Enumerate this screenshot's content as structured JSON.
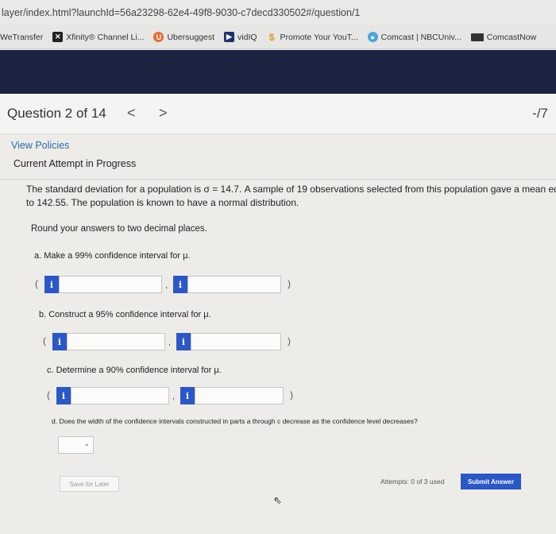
{
  "browser": {
    "url": "layer/index.html?launchId=56a23298-62e4-49f8-9030-c7decd330502#/question/1",
    "bookmarks": [
      {
        "label": "WeTransfer",
        "icon": "none"
      },
      {
        "label": "Xfinity® Channel Li...",
        "icon": "x-icon"
      },
      {
        "label": "Ubersuggest",
        "icon": "ubersuggest-icon"
      },
      {
        "label": "vidIQ",
        "icon": "vidiq-icon"
      },
      {
        "label": "Promote Your YouT...",
        "icon": "dollar-icon"
      },
      {
        "label": "Comcast | NBCUniv...",
        "icon": "comcast-icon"
      },
      {
        "label": "ComcastNow",
        "icon": "comcastnow-icon"
      }
    ]
  },
  "header": {
    "question_title": "Question 2 of 14",
    "prev_symbol": "<",
    "next_symbol": ">",
    "score": "-/7"
  },
  "policies_link": "View Policies",
  "attempt_heading": "Current Attempt in Progress",
  "question": {
    "line1": "The standard deviation for a population is σ = 14.7. A sample of 19 observations selected from this population gave a mean equa",
    "line2": "to 142.55. The population is known to have a normal distribution.",
    "round_instruction": "Round your answers to two decimal places."
  },
  "parts": {
    "a": "a. Make a 99% confidence interval for μ.",
    "b": "b. Construct a 95% confidence interval for μ.",
    "c": "c. Determine a 90% confidence interval for μ.",
    "d": "d. Does the width of the confidence intervals constructed in parts a through c decrease as the confidence level decreases?"
  },
  "symbols": {
    "open_paren": "(",
    "close_paren": ")",
    "comma": ",",
    "info": "i",
    "chevron": "⌄"
  },
  "footer": {
    "save_label": "Save for Later",
    "attempts_text": "Attempts: 0 of 3 used",
    "submit_label": "Submit Answer"
  },
  "colors": {
    "nav_band": "#1c2340",
    "accent_blue": "#2b57c8",
    "link_blue": "#2a6cb0"
  }
}
